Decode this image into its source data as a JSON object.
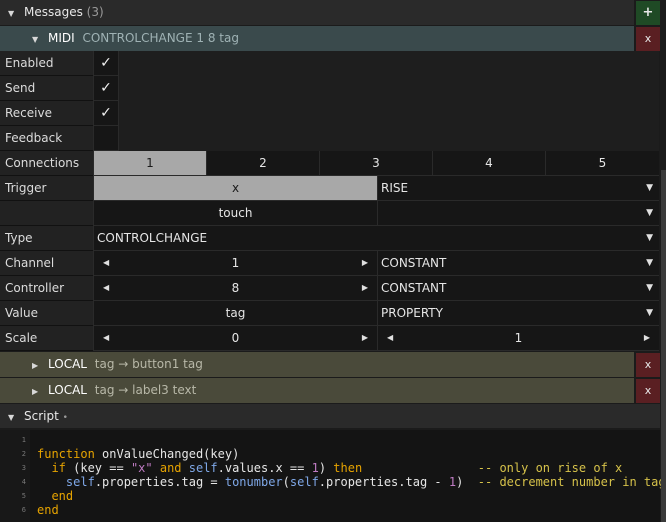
{
  "messages": {
    "title": "Messages",
    "count": "(3)",
    "add_label": "+"
  },
  "midi": {
    "title": "MIDI",
    "subtitle": "CONTROLCHANGE 1 8 tag",
    "close": "x"
  },
  "rows": {
    "enabled": "Enabled",
    "send": "Send",
    "receive": "Receive",
    "feedback": "Feedback",
    "connections": "Connections",
    "trigger": "Trigger",
    "type": "Type",
    "channel": "Channel",
    "controller": "Controller",
    "value": "Value",
    "scale": "Scale"
  },
  "checks": {
    "enabled": "✓",
    "send": "✓",
    "receive": "✓"
  },
  "connections": [
    "1",
    "2",
    "3",
    "4",
    "5"
  ],
  "trigger": {
    "field": "x",
    "mode": "RISE",
    "field2": "touch",
    "mode2": ""
  },
  "type": {
    "value": "CONTROLCHANGE"
  },
  "channel": {
    "value": "1",
    "mode": "CONSTANT"
  },
  "controller": {
    "value": "8",
    "mode": "CONSTANT"
  },
  "value": {
    "value": "tag",
    "mode": "PROPERTY"
  },
  "scale": {
    "min": "0",
    "max": "1"
  },
  "locals": [
    {
      "title": "LOCAL",
      "detail": "tag → button1 tag",
      "close": "x"
    },
    {
      "title": "LOCAL",
      "detail": "tag → label3 text",
      "close": "x"
    }
  ],
  "script": {
    "title": "Script",
    "dirty": "•",
    "line_numbers": [
      "1",
      "2",
      "3",
      "4",
      "5",
      "6"
    ],
    "lines": [
      [],
      [
        {
          "t": "function",
          "c": "fn"
        },
        {
          "t": " onValueChanged(key)",
          "c": "plain"
        }
      ],
      [
        {
          "t": "  ",
          "c": "plain"
        },
        {
          "t": "if",
          "c": "kw"
        },
        {
          "t": " (key == ",
          "c": "plain"
        },
        {
          "t": "\"x\"",
          "c": "str"
        },
        {
          "t": " and ",
          "c": "kw"
        },
        {
          "t": "self",
          "c": "slf"
        },
        {
          "t": ".values.x == ",
          "c": "plain"
        },
        {
          "t": "1",
          "c": "num"
        },
        {
          "t": ") ",
          "c": "plain"
        },
        {
          "t": "then",
          "c": "kw"
        },
        {
          "t": "                -- only on rise of x",
          "c": "cmt"
        }
      ],
      [
        {
          "t": "    ",
          "c": "plain"
        },
        {
          "t": "self",
          "c": "slf"
        },
        {
          "t": ".properties.tag = ",
          "c": "plain"
        },
        {
          "t": "tonumber",
          "c": "slf"
        },
        {
          "t": "(",
          "c": "plain"
        },
        {
          "t": "self",
          "c": "slf"
        },
        {
          "t": ".properties.tag - ",
          "c": "plain"
        },
        {
          "t": "1",
          "c": "num"
        },
        {
          "t": ")  ",
          "c": "plain"
        },
        {
          "t": "-- decrement number in tag",
          "c": "cmt"
        }
      ],
      [
        {
          "t": "  ",
          "c": "plain"
        },
        {
          "t": "end",
          "c": "kw"
        }
      ],
      [
        {
          "t": "end",
          "c": "kw"
        }
      ]
    ]
  }
}
